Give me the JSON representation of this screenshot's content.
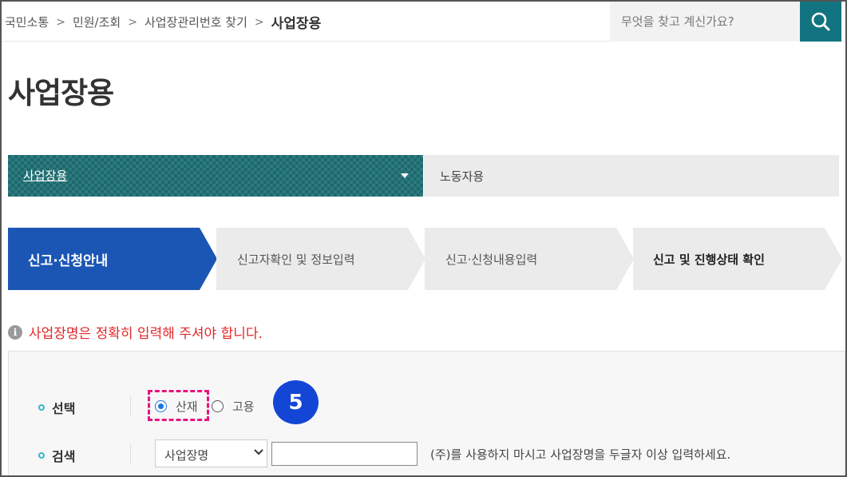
{
  "breadcrumb": {
    "items": [
      "국민소통",
      "민원/조회",
      "사업장관리번호 찾기"
    ],
    "current": "사업장용",
    "separator": ">"
  },
  "search": {
    "placeholder": "무엇을 찾고 계신가요?",
    "icon": "search-icon",
    "button_color": "#137481"
  },
  "page_title": "사업장용",
  "tabs": {
    "active": "사업장용",
    "inactive": "노동자용",
    "active_color": "#1a6a6e"
  },
  "steps": [
    {
      "label": "신고·신청안내",
      "state": "current"
    },
    {
      "label": "신고자확인 및 정보입력",
      "state": "pending"
    },
    {
      "label": "신고·신청내용입력",
      "state": "pending"
    },
    {
      "label": "신고 및 진행상태 확인",
      "state": "emphasis"
    }
  ],
  "step_colors": {
    "current": "#1b56b5",
    "pending": "#ebebeb"
  },
  "notice": {
    "icon": "info-icon",
    "icon_glyph": "i",
    "text": "사업장명은 정확히 입력해 주셔야 합니다.",
    "color": "#e0282a"
  },
  "form": {
    "select_row": {
      "label": "선택",
      "options": [
        "산재",
        "고용"
      ],
      "selected": "산재"
    },
    "search_row": {
      "label": "검색",
      "dropdown_value": "사업장명",
      "input_value": "",
      "help": "(주)를 사용하지 마시고 사업장명을 두글자 이상 입력하세요."
    }
  },
  "annotation": {
    "badge": "5",
    "badge_color": "#1446d6",
    "highlight_color": "#e6147f"
  }
}
